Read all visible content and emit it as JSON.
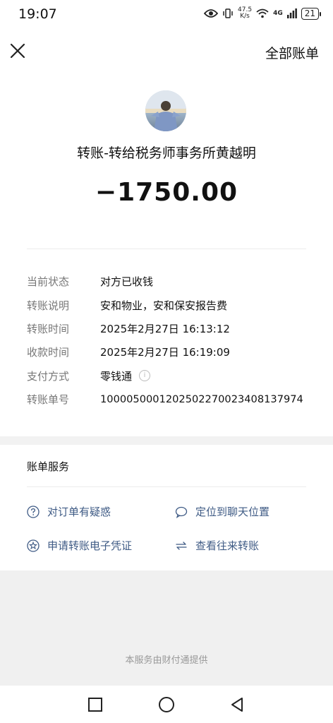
{
  "status_bar": {
    "time": "19:07",
    "net_speed_value": "47.5",
    "net_speed_unit": "K/s",
    "network": "4G",
    "battery": "21"
  },
  "header": {
    "all_bills": "全部账单"
  },
  "transfer": {
    "title": "转账-转给税务师事务所黄越明",
    "amount": "−1750.00"
  },
  "details": [
    {
      "label": "当前状态",
      "value": "对方已收钱"
    },
    {
      "label": "转账说明",
      "value": "安和物业，安和保安报告费"
    },
    {
      "label": "转账时间",
      "value": "2025年2月27日 16:13:12"
    },
    {
      "label": "收款时间",
      "value": "2025年2月27日 16:19:09"
    },
    {
      "label": "支付方式",
      "value": "零钱通"
    },
    {
      "label": "转账单号",
      "value": "100005000120250227002340813797​4"
    }
  ],
  "services": {
    "title": "账单服务",
    "items": [
      {
        "label": "对订单有疑惑",
        "icon": "question-icon"
      },
      {
        "label": "定位到聊天位置",
        "icon": "chat-bubble-icon"
      },
      {
        "label": "申请转账电子凭证",
        "icon": "star-badge-icon"
      },
      {
        "label": "查看往来转账",
        "icon": "exchange-arrows-icon"
      }
    ]
  },
  "footer": {
    "provider_text": "本服务由财付通提供"
  },
  "colors": {
    "link_blue": "#3f5b85",
    "label_gray": "#777777",
    "band_gray": "#f0f0f0"
  }
}
